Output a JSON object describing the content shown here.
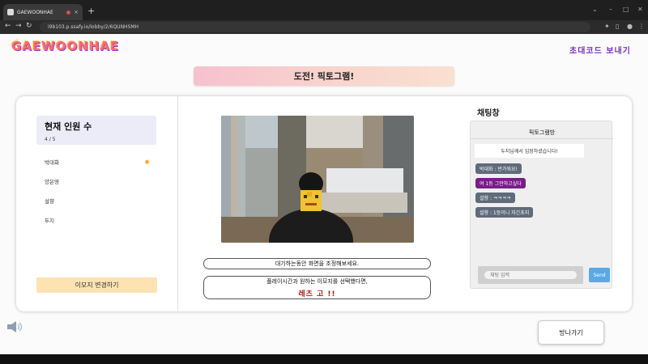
{
  "browser": {
    "tab_title": "GAEWOONHAE",
    "url": "i9b103.p.ssafy.io/lobby/2/6QUNHSMH",
    "new_tab": "+",
    "tab_close": "×"
  },
  "header": {
    "logo": "GAEWOONHAE",
    "invite_label": "초대코드 보내기"
  },
  "banner": {
    "title": "도전! 픽토그램!"
  },
  "players": {
    "title": "현재 인원 수",
    "count": "4 / 5",
    "members": [
      {
        "name": "박대화",
        "host": true
      },
      {
        "name": "양은영",
        "host": false
      },
      {
        "name": "설향",
        "host": false
      },
      {
        "name": "두지",
        "host": false
      }
    ],
    "emoji_button": "이모지 변경하기"
  },
  "game": {
    "hint_adjust": "대기하는동안 화면을 조정해보세요.",
    "hint_select": "플레이시간과 원하는 이모지를 선택했다면,",
    "hint_go": "레츠 고 !!"
  },
  "chat": {
    "header": "채팅창",
    "room_title": "픽토그램방",
    "system_message": "두지님께서 입장하셨습니다!",
    "messages": [
      {
        "text": "박대화 : 반가워요!",
        "color": "#5f6b7a"
      },
      {
        "text": "여 1등 그만하고싶다",
        "color": "#7a1d8a"
      },
      {
        "text": "설향 : ㅋㅋㅋㅋ",
        "color": "#5f6b7a"
      },
      {
        "text": "설향 : 1등이니 자긴초지",
        "color": "#5f6b7a"
      }
    ],
    "input_placeholder": "채팅 입력",
    "send_label": "Send"
  },
  "footer": {
    "leave_label": "방나가기"
  },
  "colors": {
    "accent_purple": "#7b2fbf",
    "banner_pink": "#f6c1cf",
    "emoji_button": "#fde3b2",
    "send_button": "#5aa9e6"
  }
}
